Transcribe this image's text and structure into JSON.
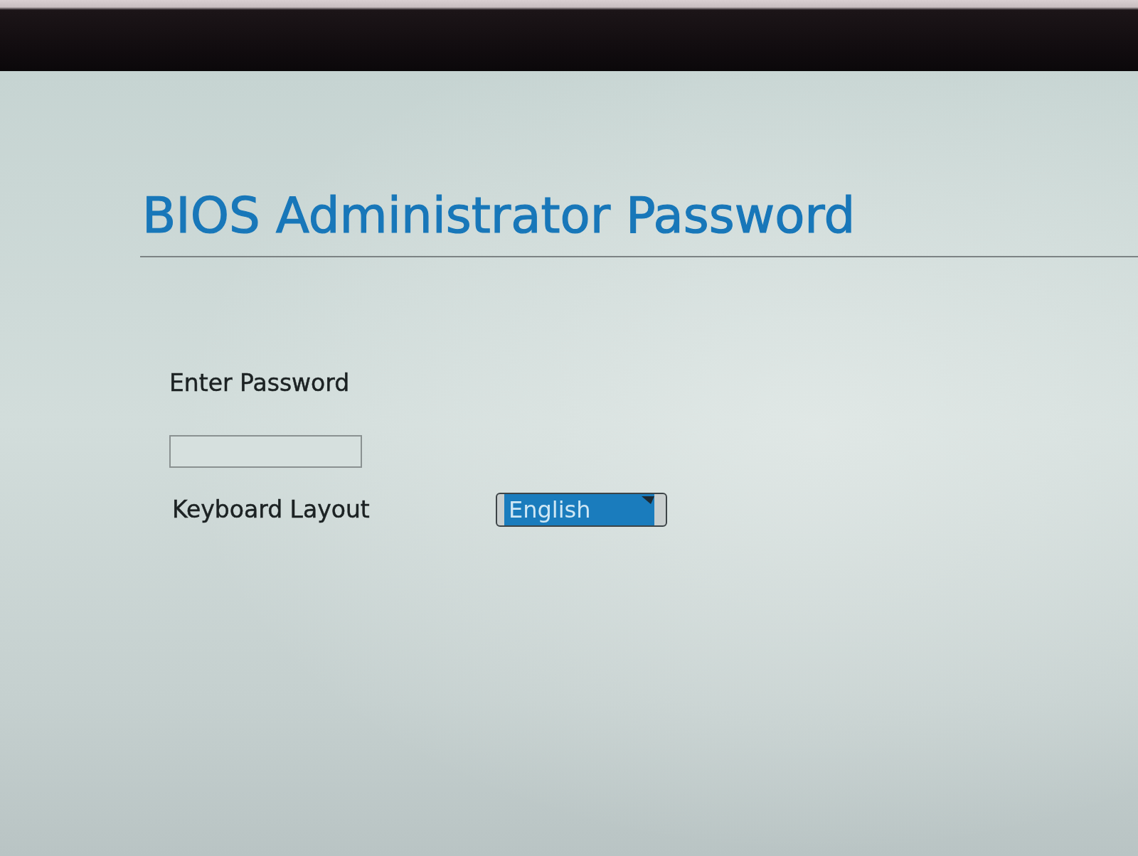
{
  "screen": {
    "title": "BIOS Administrator Password"
  },
  "password": {
    "label": "Enter Password"
  },
  "keyboard_layout": {
    "label": "Keyboard Layout",
    "value": "English",
    "focused": true
  }
}
